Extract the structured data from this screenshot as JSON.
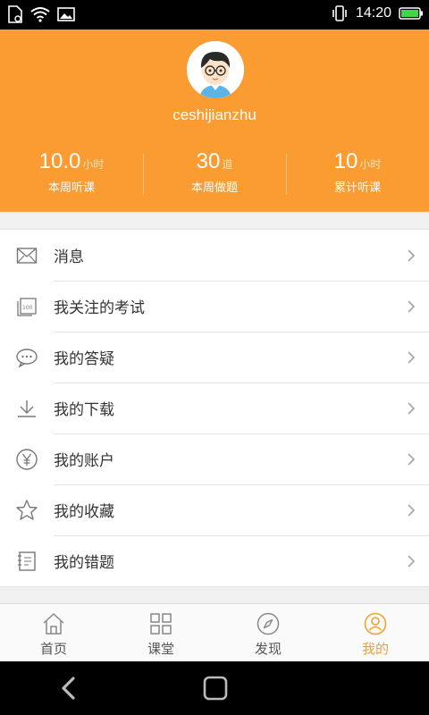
{
  "status_bar": {
    "time": "14:20"
  },
  "profile": {
    "username": "ceshijianzhu",
    "stats": [
      {
        "value": "10.0",
        "unit": "小时",
        "label": "本周听课"
      },
      {
        "value": "30",
        "unit": "道",
        "label": "本周做题"
      },
      {
        "value": "10",
        "unit": "小时",
        "label": "累计听课"
      }
    ]
  },
  "menu": {
    "items": [
      {
        "label": "消息",
        "icon": "envelope-icon"
      },
      {
        "label": "我关注的考试",
        "icon": "exam-icon"
      },
      {
        "label": "我的答疑",
        "icon": "chat-bubble-icon"
      },
      {
        "label": "我的下载",
        "icon": "download-icon"
      },
      {
        "label": "我的账户",
        "icon": "yen-icon"
      },
      {
        "label": "我的收藏",
        "icon": "star-icon"
      },
      {
        "label": "我的错题",
        "icon": "error-book-icon"
      }
    ]
  },
  "tabbar": {
    "tabs": [
      {
        "label": "首页",
        "icon": "home-icon",
        "active": false
      },
      {
        "label": "课堂",
        "icon": "grid-icon",
        "active": false
      },
      {
        "label": "发现",
        "icon": "compass-icon",
        "active": false
      },
      {
        "label": "我的",
        "icon": "user-icon",
        "active": true
      }
    ]
  },
  "colors": {
    "header_bg": "#fb9c33",
    "accent": "#f0a033",
    "text": "#333333"
  }
}
